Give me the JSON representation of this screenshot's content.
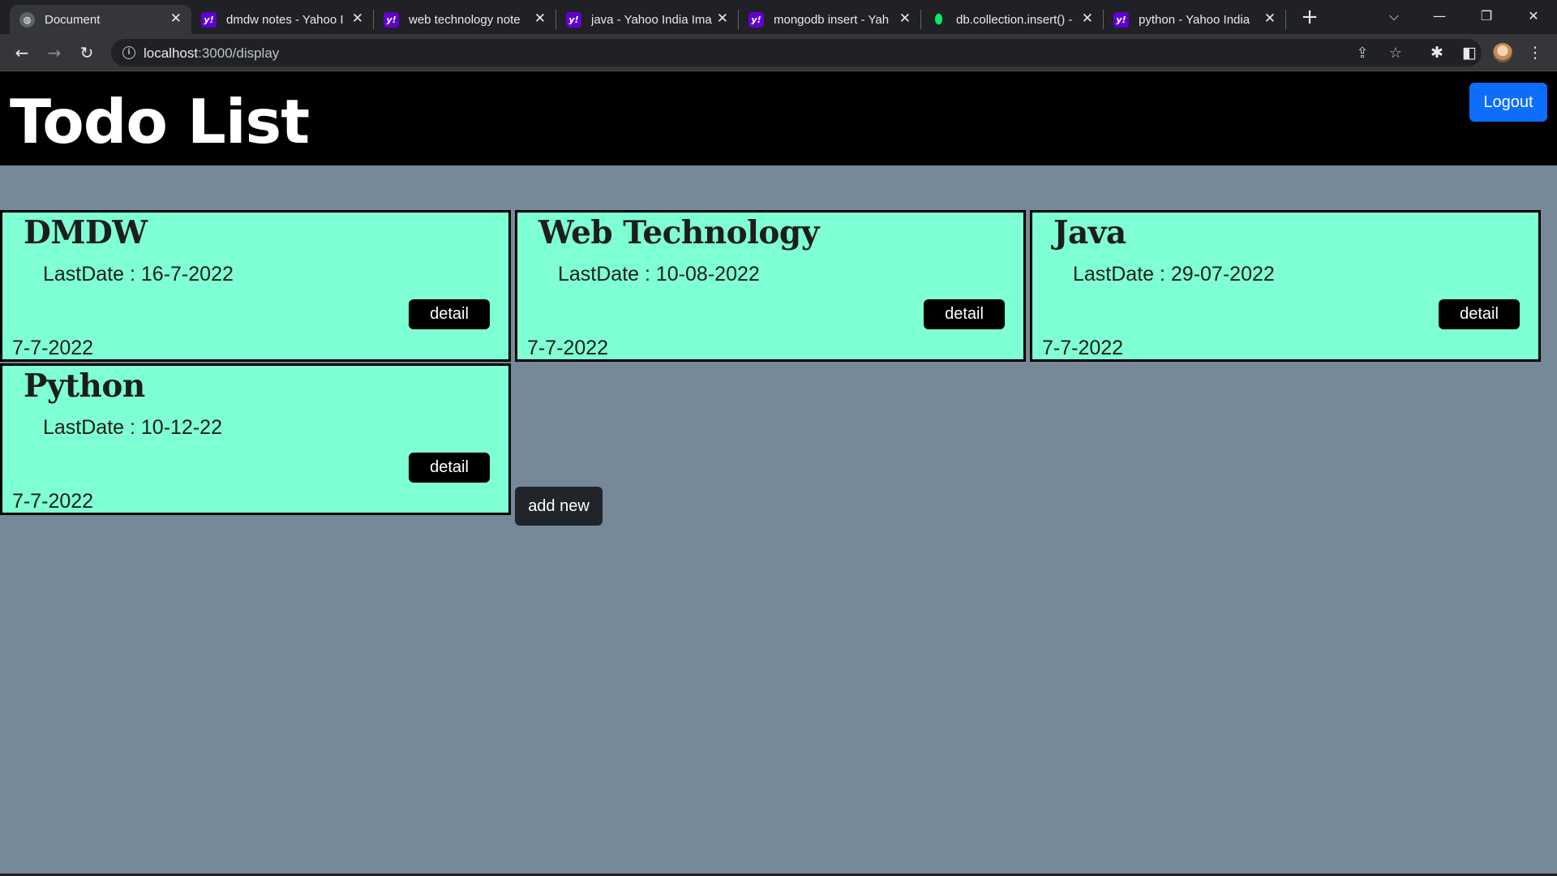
{
  "browser": {
    "tabs": [
      {
        "title": "Document",
        "favicon": "globe-icon",
        "active": true
      },
      {
        "title": "dmdw notes - Yahoo I",
        "favicon": "yahoo-icon",
        "active": false
      },
      {
        "title": "web technology note",
        "favicon": "yahoo-icon",
        "active": false
      },
      {
        "title": "java - Yahoo India Ima",
        "favicon": "yahoo-icon",
        "active": false
      },
      {
        "title": "mongodb insert - Yah",
        "favicon": "yahoo-icon",
        "active": false
      },
      {
        "title": "db.collection.insert() -",
        "favicon": "mongodb-leaf-icon",
        "active": false
      },
      {
        "title": "python - Yahoo India",
        "favicon": "yahoo-icon",
        "active": false
      }
    ],
    "url_host": "localhost",
    "url_rest": ":3000/display",
    "icons": {
      "back": "back-arrow-icon",
      "forward": "forward-arrow-icon",
      "reload": "reload-icon",
      "share": "share-icon",
      "bookmark": "star-icon",
      "extensions": "puzzle-icon",
      "sidepanel": "side-panel-icon",
      "menu": "kebab-menu-icon"
    }
  },
  "header": {
    "title": "Todo List",
    "logout_label": "Logout"
  },
  "todos": [
    {
      "title": "DMDW",
      "last_date_text": "LastDate : 16-7-2022",
      "detail_label": "detail",
      "created": "7-7-2022"
    },
    {
      "title": "Web Technology",
      "last_date_text": "LastDate : 10-08-2022",
      "detail_label": "detail",
      "created": "7-7-2022"
    },
    {
      "title": "Java",
      "last_date_text": "LastDate : 29-07-2022",
      "detail_label": "detail",
      "created": "7-7-2022"
    },
    {
      "title": "Python",
      "last_date_text": "LastDate : 10-12-22",
      "detail_label": "detail",
      "created": "7-7-2022"
    }
  ],
  "add_new_label": "add new",
  "colors": {
    "page_bg": "#778899",
    "card_bg": "#7fffd4",
    "header_bg": "#000000",
    "logout_bg": "#0d6efd",
    "add_new_bg": "#212529"
  }
}
